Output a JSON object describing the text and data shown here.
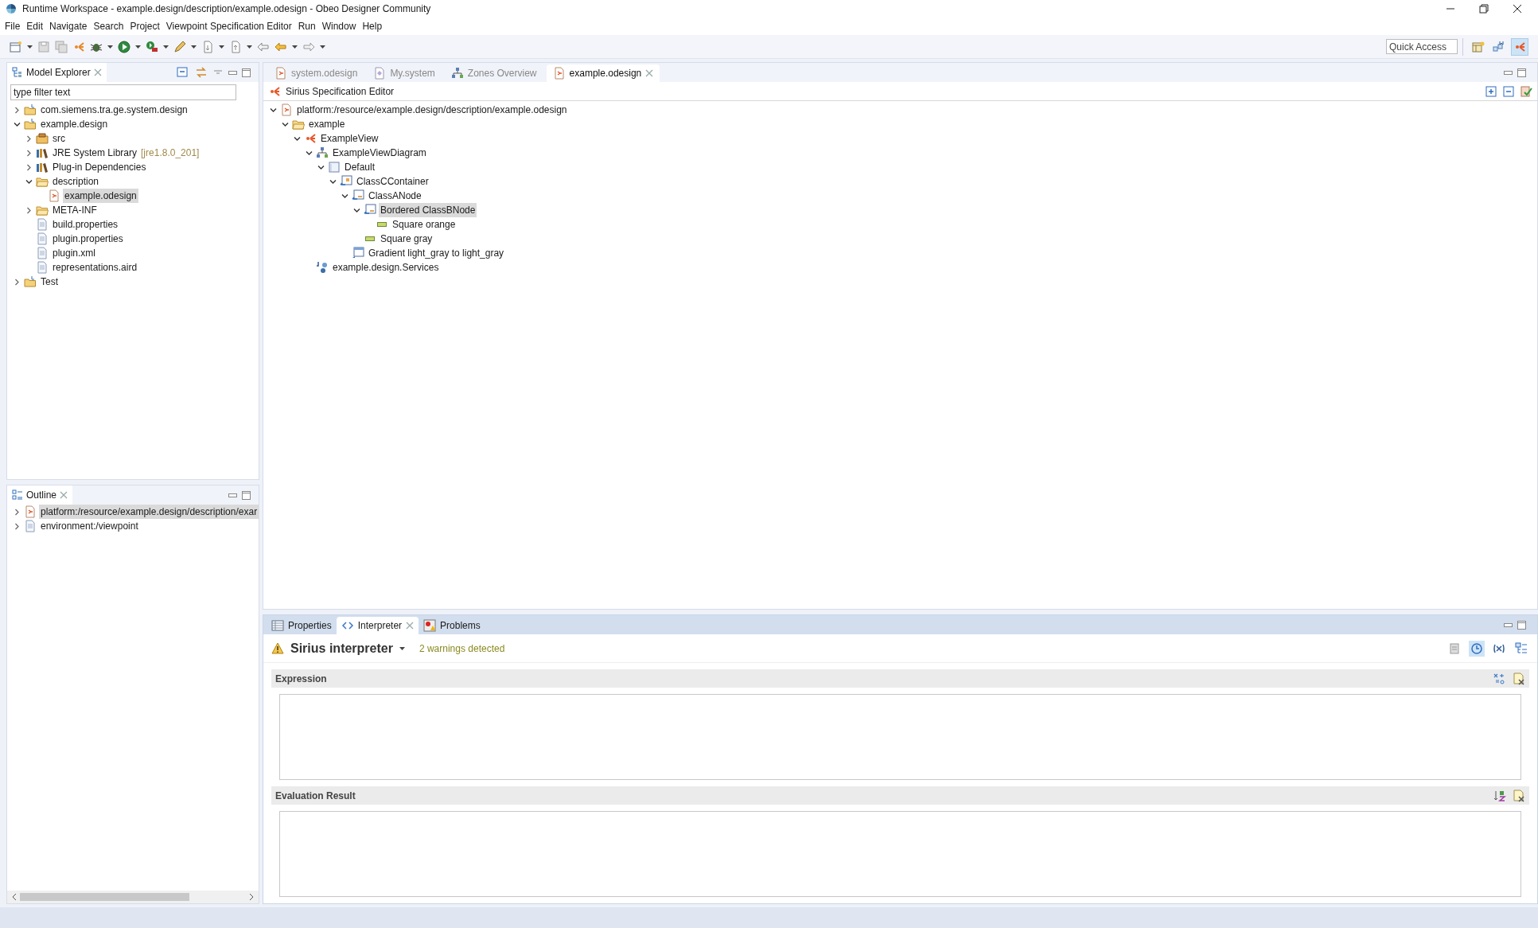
{
  "window": {
    "title": "Runtime Workspace - example.design/description/example.odesign - Obeo Designer Community"
  },
  "menu": [
    "File",
    "Edit",
    "Navigate",
    "Search",
    "Project",
    "Viewpoint Specification Editor",
    "Run",
    "Window",
    "Help"
  ],
  "quick_access": {
    "placeholder": "Quick Access"
  },
  "perspectives": [
    {
      "kind": "open",
      "selected": false
    },
    {
      "kind": "modeling",
      "selected": false
    },
    {
      "kind": "sirius",
      "selected": true
    }
  ],
  "model_explorer": {
    "title": "Model Explorer",
    "filter": {
      "placeholder": "type filter text"
    },
    "items": [
      {
        "label": "com.siemens.tra.ge.system.design",
        "kind": "project",
        "expanded": false,
        "selected": false
      },
      {
        "label": "example.design",
        "kind": "project",
        "expanded": true,
        "selected": false,
        "children": [
          {
            "label": "src",
            "kind": "package",
            "expanded": false,
            "selected": false
          },
          {
            "label": "JRE System Library",
            "decoration": "[jre1.8.0_201]",
            "kind": "library",
            "expanded": false,
            "selected": false
          },
          {
            "label": "Plug-in Dependencies",
            "kind": "library",
            "expanded": false,
            "selected": false
          },
          {
            "label": "description",
            "kind": "folder",
            "expanded": true,
            "selected": false,
            "children": [
              {
                "label": "example.odesign",
                "kind": "odesign",
                "selected": true
              }
            ]
          },
          {
            "label": "META-INF",
            "kind": "folder",
            "expanded": false,
            "selected": false
          },
          {
            "label": "build.properties",
            "kind": "file",
            "selected": false
          },
          {
            "label": "plugin.properties",
            "kind": "file",
            "selected": false
          },
          {
            "label": "plugin.xml",
            "kind": "file",
            "selected": false
          },
          {
            "label": "representations.aird",
            "kind": "file",
            "selected": false
          }
        ]
      },
      {
        "label": "Test",
        "kind": "project",
        "expanded": false,
        "selected": false
      }
    ]
  },
  "outline": {
    "title": "Outline",
    "items": [
      {
        "label": "platform:/resource/example.design/description/exar",
        "kind": "odesign",
        "expanded": false,
        "selected": true
      },
      {
        "label": "environment:/viewpoint",
        "kind": "file",
        "expanded": false,
        "selected": false
      }
    ]
  },
  "editor_tabs": [
    {
      "label": "system.odesign",
      "kind": "odesign",
      "selected": false
    },
    {
      "label": "My.system",
      "kind": "system",
      "selected": false
    },
    {
      "label": "Zones Overview",
      "kind": "diagram",
      "selected": false
    },
    {
      "label": "example.odesign",
      "kind": "odesign",
      "selected": true
    }
  ],
  "editor": {
    "title": "Sirius Specification Editor",
    "items": [
      {
        "label": "platform:/resource/example.design/description/example.odesign",
        "kind": "odesign",
        "expanded": true,
        "selected": false,
        "children": [
          {
            "label": "example",
            "kind": "folder",
            "expanded": true,
            "selected": false,
            "children": [
              {
                "label": "ExampleView",
                "kind": "viewpoint",
                "expanded": true,
                "selected": false,
                "children": [
                  {
                    "label": "ExampleViewDiagram",
                    "kind": "diagram",
                    "expanded": true,
                    "selected": false,
                    "children": [
                      {
                        "label": "Default",
                        "kind": "layer",
                        "expanded": true,
                        "selected": false,
                        "children": [
                          {
                            "label": "ClassCContainer",
                            "kind": "container",
                            "expanded": true,
                            "selected": false,
                            "children": [
                              {
                                "label": "ClassANode",
                                "kind": "node",
                                "expanded": true,
                                "selected": false,
                                "children": [
                                  {
                                    "label": "Bordered ClassBNode",
                                    "kind": "node",
                                    "expanded": true,
                                    "selected": true,
                                    "children": [
                                      {
                                        "label": "Square orange",
                                        "kind": "style",
                                        "selected": false
                                      }
                                    ]
                                  },
                                  {
                                    "label": "Square gray",
                                    "kind": "style",
                                    "selected": false
                                  }
                                ]
                              },
                              {
                                "label": "Gradient light_gray to light_gray",
                                "kind": "gradient",
                                "selected": false
                              }
                            ]
                          }
                        ]
                      }
                    ]
                  },
                  {
                    "label": "example.design.Services",
                    "kind": "java",
                    "selected": false
                  }
                ]
              }
            ]
          }
        ]
      }
    ]
  },
  "bottom_tabs": [
    {
      "label": "Properties",
      "kind": "properties",
      "selected": false
    },
    {
      "label": "Interpreter",
      "kind": "interpreter",
      "selected": true
    },
    {
      "label": "Problems",
      "kind": "problems",
      "selected": false
    }
  ],
  "interpreter": {
    "title": "Sirius interpreter",
    "status": "2 warnings detected",
    "toolbar": [
      {
        "kind": "link",
        "selected": false
      },
      {
        "kind": "clock",
        "selected": true
      },
      {
        "kind": "variables",
        "selected": false
      },
      {
        "kind": "outline",
        "selected": false
      }
    ],
    "sections": [
      {
        "title": "Expression",
        "kind": "expression"
      },
      {
        "title": "Evaluation Result",
        "kind": "result"
      }
    ]
  }
}
